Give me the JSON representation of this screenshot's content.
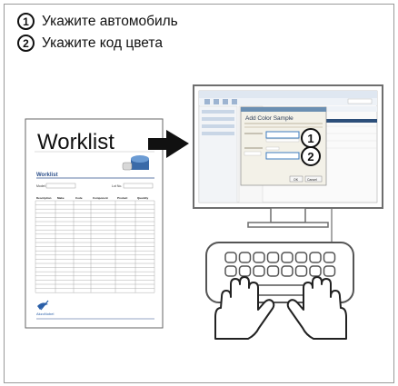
{
  "steps": [
    {
      "number": "1",
      "text": "Укажите автомобиль"
    },
    {
      "number": "2",
      "text": "Укажите код цвета"
    }
  ],
  "worklist_card": {
    "heading": "Worklist",
    "form_title": "Worklist",
    "field_label_1": "Model:",
    "field_label_2": "Lot No.",
    "table_headers": [
      "Description",
      "Make",
      "Code",
      "Component",
      "Product",
      "Quantity"
    ],
    "logo_text": "AkzoNobel"
  },
  "dialog": {
    "title": "Add Color Sample",
    "callout_1": "1",
    "callout_2": "2",
    "ok_label": "OK",
    "cancel_label": "Cancel"
  },
  "colors": {
    "screen_border": "#6e6e6e",
    "dialog_bg": "#f3f1e8",
    "dialog_title": "#6b8fb2",
    "highlight": "#3e7cbf",
    "arrow": "#111111"
  }
}
